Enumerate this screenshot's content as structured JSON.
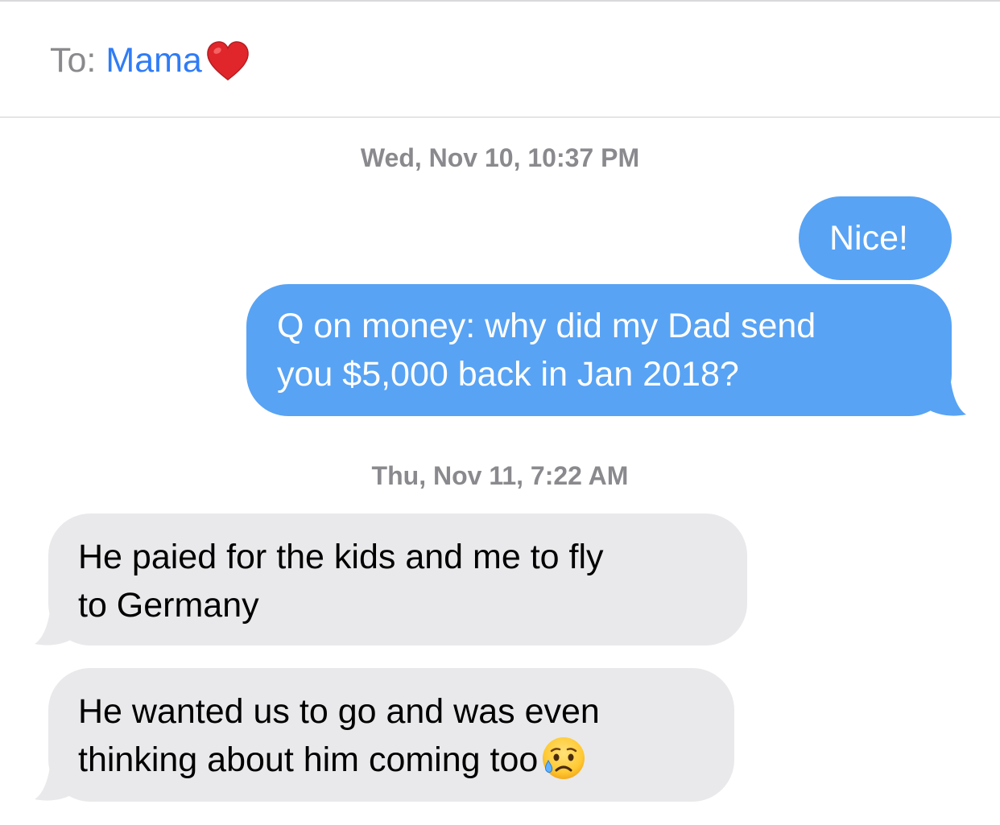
{
  "header": {
    "to_label": "To:",
    "contact_name": "Mama",
    "contact_icon": "red-heart-emoji"
  },
  "conversation": {
    "groups": [
      {
        "timestamp": "Wed, Nov 10, 10:37 PM",
        "messages": [
          {
            "direction": "outgoing",
            "lines": [
              "Nice!"
            ]
          },
          {
            "direction": "outgoing",
            "lines": [
              "Q on money: why did my Dad send",
              "you $5,000 back in Jan 2018?"
            ]
          }
        ]
      },
      {
        "timestamp": "Thu, Nov 11, 7:22 AM",
        "messages": [
          {
            "direction": "incoming",
            "lines": [
              "He paied for the kids and me to fly",
              "to Germany"
            ]
          },
          {
            "direction": "incoming",
            "lines": [
              "He wanted us to go and was even",
              "thinking about him coming too"
            ],
            "trailing_icon": "sad-but-relieved-face-emoji"
          }
        ]
      }
    ]
  },
  "colors": {
    "outgoing_bubble": "#58a3f4",
    "incoming_bubble": "#e9e9eb",
    "contact_link": "#2f7cf6",
    "secondary_text": "#8a8a8e"
  }
}
